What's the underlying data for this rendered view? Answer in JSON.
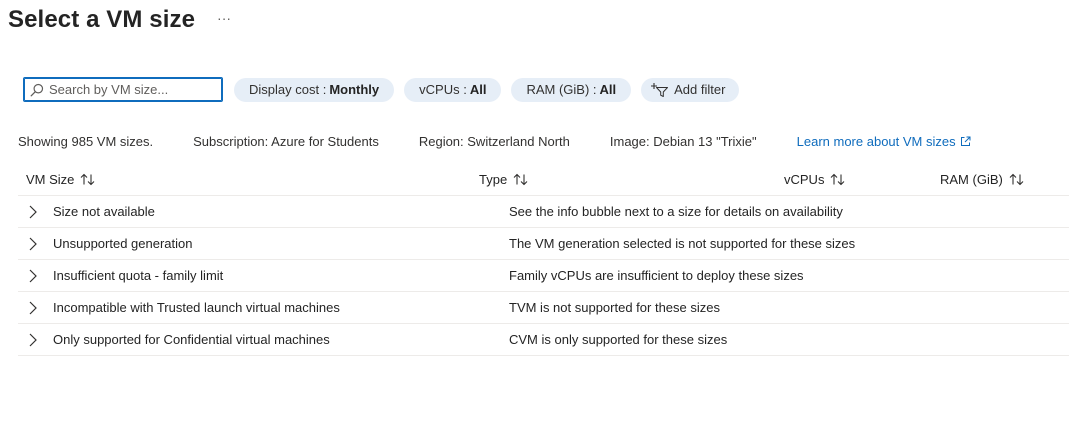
{
  "header": {
    "title": "Select a VM size",
    "more_label": "···"
  },
  "toolbar": {
    "search_placeholder": "Search by VM size...",
    "search_value": "",
    "filters": [
      {
        "label": "Display cost :",
        "value": "Monthly"
      },
      {
        "label": "vCPUs :",
        "value": "All"
      },
      {
        "label": "RAM (GiB) :",
        "value": "All"
      }
    ],
    "add_filter_label": "Add filter"
  },
  "info": {
    "showing": "Showing 985 VM sizes.",
    "subscription": "Subscription: Azure for Students",
    "region": "Region: Switzerland North",
    "image": "Image: Debian 13 \"Trixie\"",
    "learn_more": "Learn more about VM sizes"
  },
  "table": {
    "columns": [
      "VM Size",
      "Type",
      "vCPUs",
      "RAM (GiB)"
    ],
    "groups": [
      {
        "name": "Size not available",
        "description": "See the info bubble next to a size for details on availability"
      },
      {
        "name": "Unsupported generation",
        "description": "The VM generation selected is not supported for these sizes"
      },
      {
        "name": "Insufficient quota - family limit",
        "description": "Family vCPUs are insufficient to deploy these sizes"
      },
      {
        "name": "Incompatible with Trusted launch virtual machines",
        "description": "TVM is not supported for these sizes"
      },
      {
        "name": "Only supported for Confidential virtual machines",
        "description": "CVM is only supported for these sizes"
      }
    ]
  },
  "icons": {
    "search": "search-icon",
    "add_filter": "add-filter-icon",
    "external_link": "external-link-icon",
    "sort": "sort-icon",
    "expand": "chevron-right-icon"
  },
  "colors": {
    "link": "#0f6cbd",
    "pill_background": "#e6eef7",
    "focus_border": "#0f6cbd",
    "divider": "#edebe9"
  }
}
